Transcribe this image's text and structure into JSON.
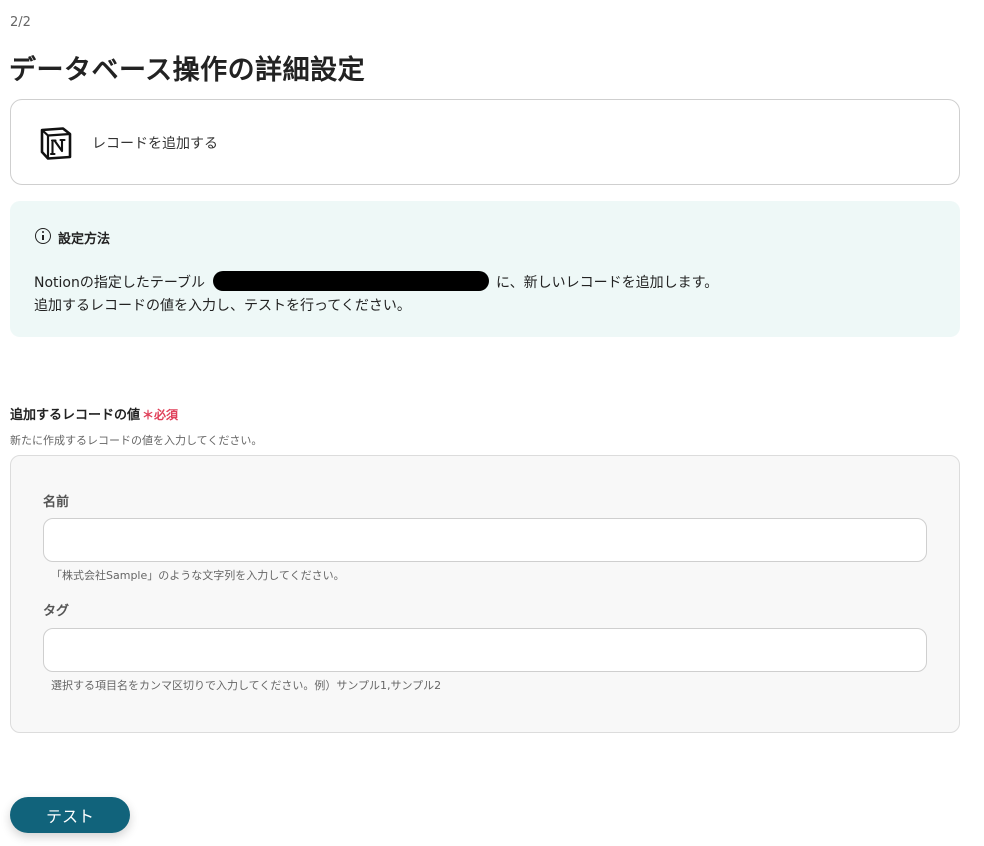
{
  "header": {
    "step": "2/2",
    "title": "データベース操作の詳細設定"
  },
  "action_card": {
    "icon": "notion-logo",
    "label": "レコードを追加する"
  },
  "info_box": {
    "icon": "info-icon",
    "title": "設定方法",
    "line1_prefix": "Notionの指定したテーブル",
    "line1_suffix": "に、新しいレコードを追加します。",
    "line2": "追加するレコードの値を入力し、テストを行ってください。"
  },
  "record_section": {
    "label": "追加するレコードの値",
    "required_mark": "＊必須",
    "description": "新たに作成するレコードの値を入力してください。",
    "fields": [
      {
        "label": "名前",
        "value": "",
        "hint": "「株式会社Sample」のような文字列を入力してください。"
      },
      {
        "label": "タグ",
        "value": "",
        "hint": "選択する項目名をカンマ区切りで入力してください。例）サンプル1,サンプル2"
      }
    ]
  },
  "actions": {
    "test_label": "テスト",
    "accent_color": "#11637b"
  }
}
